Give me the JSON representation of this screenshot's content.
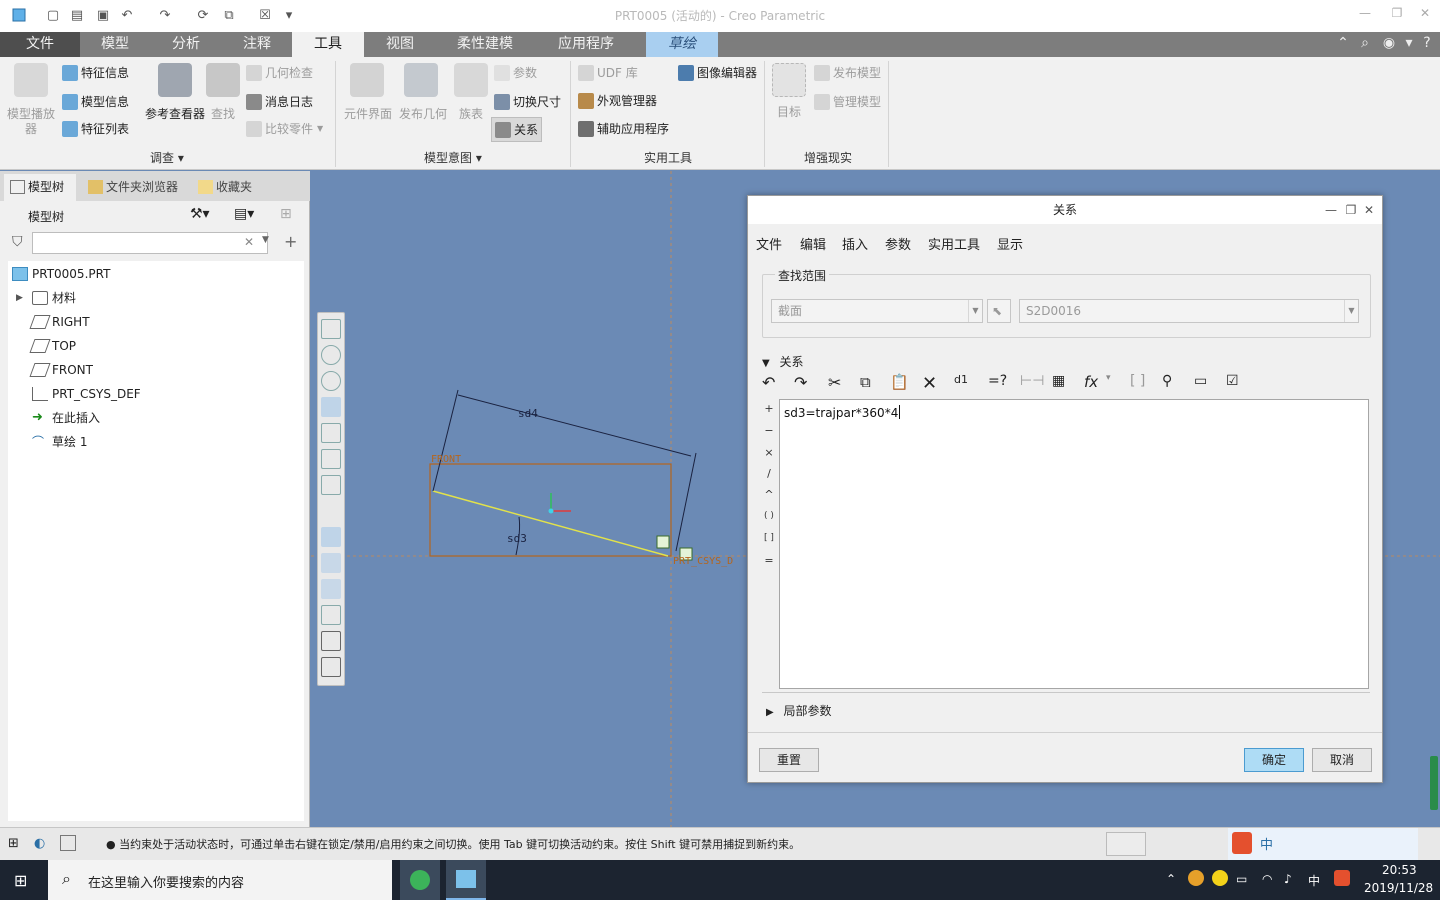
{
  "app": {
    "title": "PRT0005 (活动的) - Creo Parametric"
  },
  "ribbon_tabs": [
    {
      "label": "文件"
    },
    {
      "label": "模型"
    },
    {
      "label": "分析"
    },
    {
      "label": "注释"
    },
    {
      "label": "工具"
    },
    {
      "label": "视图"
    },
    {
      "label": "柔性建模"
    },
    {
      "label": "应用程序"
    },
    {
      "label": "草绘"
    }
  ],
  "ribbon": {
    "model_play": "模型播放器",
    "feature_info": "特征信息",
    "model_info": "模型信息",
    "feature_list": "特征列表",
    "reference_viewer": "参考查看器",
    "find": "查找",
    "geometry_check": "几何检查",
    "message_log": "消息日志",
    "compare_parts": "比较零件",
    "investigate_group": "调查",
    "component_interface": "元件界面",
    "publish_geometry": "发布几何",
    "family_table": "族表",
    "params": "参数",
    "switch_dims": "切换尺寸",
    "relations": "关系",
    "model_intent_group": "模型意图",
    "udf_library": "UDF 库",
    "appearance_manager": "外观管理器",
    "aux_applications": "辅助应用程序",
    "image_editor": "图像编辑器",
    "utilities_group": "实用工具",
    "target": "目标",
    "publish_model": "发布模型",
    "manage_model": "管理模型",
    "ar_group": "增强现实"
  },
  "left_panel": {
    "tabs": [
      {
        "label": "模型树"
      },
      {
        "label": "文件夹浏览器"
      },
      {
        "label": "收藏夹"
      }
    ],
    "header": "模型树",
    "filter_placeholder": "",
    "tree": [
      {
        "label": "PRT0005.PRT",
        "icon": "part-icon"
      },
      {
        "label": "材料",
        "icon": "material-icon"
      },
      {
        "label": "RIGHT",
        "icon": "datum-plane-icon"
      },
      {
        "label": "TOP",
        "icon": "datum-plane-icon"
      },
      {
        "label": "FRONT",
        "icon": "datum-plane-icon"
      },
      {
        "label": "PRT_CSYS_DEF",
        "icon": "csys-icon"
      },
      {
        "label": "在此插入",
        "icon": "insert-arrow-icon"
      },
      {
        "label": "草绘 1",
        "icon": "sketch-icon"
      }
    ]
  },
  "sketch": {
    "dim_top": "sd4",
    "dim_angle": "sd3",
    "plane_label": "FRONT",
    "csys_label": "PRT_CSYS_D"
  },
  "dialog": {
    "title": "关系",
    "menu": [
      "文件",
      "编辑",
      "插入",
      "参数",
      "实用工具",
      "显示"
    ],
    "scope_legend": "查找范围",
    "scope_type": "截面",
    "scope_value": "S2D0016",
    "relations_section": "关系",
    "operators": [
      "+",
      "−",
      "×",
      "/",
      "^",
      "( )",
      "[ ]",
      "="
    ],
    "relation_text": "sd3=trajpar*360*4",
    "local_params": "局部参数",
    "reset": "重置",
    "ok": "确定",
    "cancel": "取消"
  },
  "status": {
    "message": "● 当约束处于活动状态时，可通过单击右键在锁定/禁用/启用约束之间切换。使用 Tab 键可切换活动约束。按住 Shift 键可禁用捕捉到新约束。"
  },
  "taskbar": {
    "search_placeholder": "在这里输入你要搜索的内容",
    "ime": "中",
    "time": "20:53",
    "date": "2019/11/28"
  },
  "colors": {
    "graphics_bg": "#6b8ab5",
    "sketch_line": "#e2e24a",
    "sketch_rect": "#b5651d",
    "accent": "#aedcf5"
  }
}
